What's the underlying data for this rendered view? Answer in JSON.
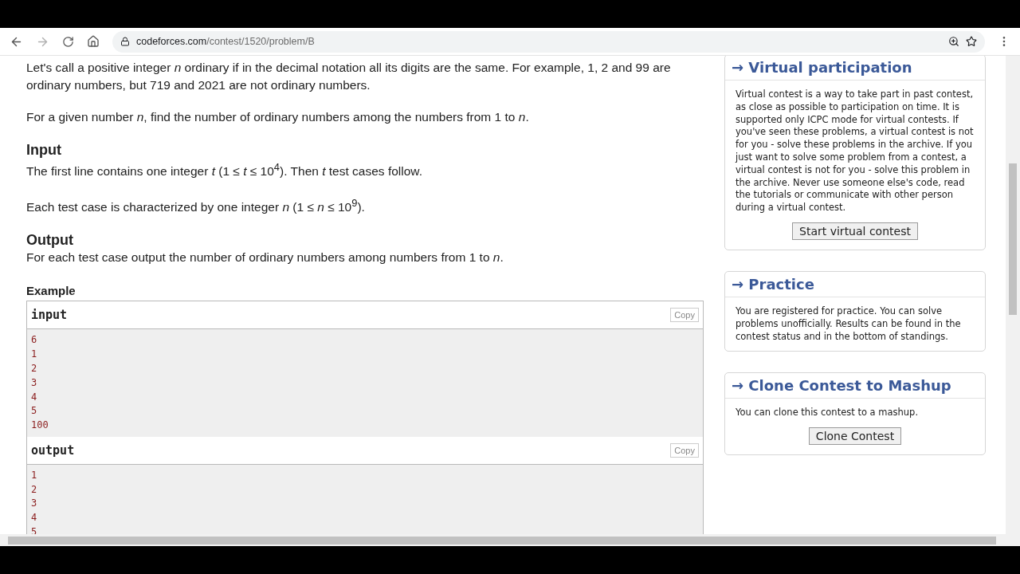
{
  "browser": {
    "url_host": "codeforces.com",
    "url_path": "/contest/1520/problem/B"
  },
  "problem": {
    "paragraphs": [
      "Let's call a positive integer *n* ordinary if in the decimal notation all its digits are the same. For example, 1, 2 and 99 are ordinary numbers, but 719 and 2021 are not ordinary numbers.",
      "For a given number *n*, find the number of ordinary numbers among the numbers from 1 to *n*."
    ],
    "sections": [
      {
        "title": "Input",
        "paragraphs": [
          "The first line contains one integer *t* (1 ≤ *t* ≤ 10$^{4}$). Then *t* test cases follow.",
          "Each test case is characterized by one integer *n* (1 ≤ *n* ≤ 10$^{9}$)."
        ]
      },
      {
        "title": "Output",
        "paragraphs": [
          "For each test case output the number of ordinary numbers among numbers from 1 to *n*."
        ]
      }
    ],
    "example": {
      "title": "Example",
      "blocks": [
        {
          "title": "input",
          "copy": "Copy",
          "lines": [
            "6",
            "1",
            "2",
            "3",
            "4",
            "5",
            "100"
          ]
        },
        {
          "title": "output",
          "copy": "Copy",
          "lines": [
            "1",
            "2",
            "3",
            "4",
            "5"
          ]
        }
      ]
    }
  },
  "sidebar": [
    {
      "title": "→ Virtual participation",
      "text": "Virtual contest is a way to take part in past contest, as close as possible to participation on time. It is supported only ICPC mode for virtual contests. If you've seen these problems, a virtual contest is not for you - solve these problems in the archive. If you just want to solve some problem from a contest, a virtual contest is not for you - solve this problem in the archive. Never use someone else's code, read the tutorials or communicate with other person during a virtual contest.",
      "button": "Start virtual contest"
    },
    {
      "title": "→ Practice",
      "text": "You are registered for practice. You can solve problems unofficially. Results can be found in the contest status and in the bottom of standings."
    },
    {
      "title": "→ Clone Contest to Mashup",
      "text": "You can clone this contest to a mashup.",
      "button": "Clone Contest"
    }
  ]
}
